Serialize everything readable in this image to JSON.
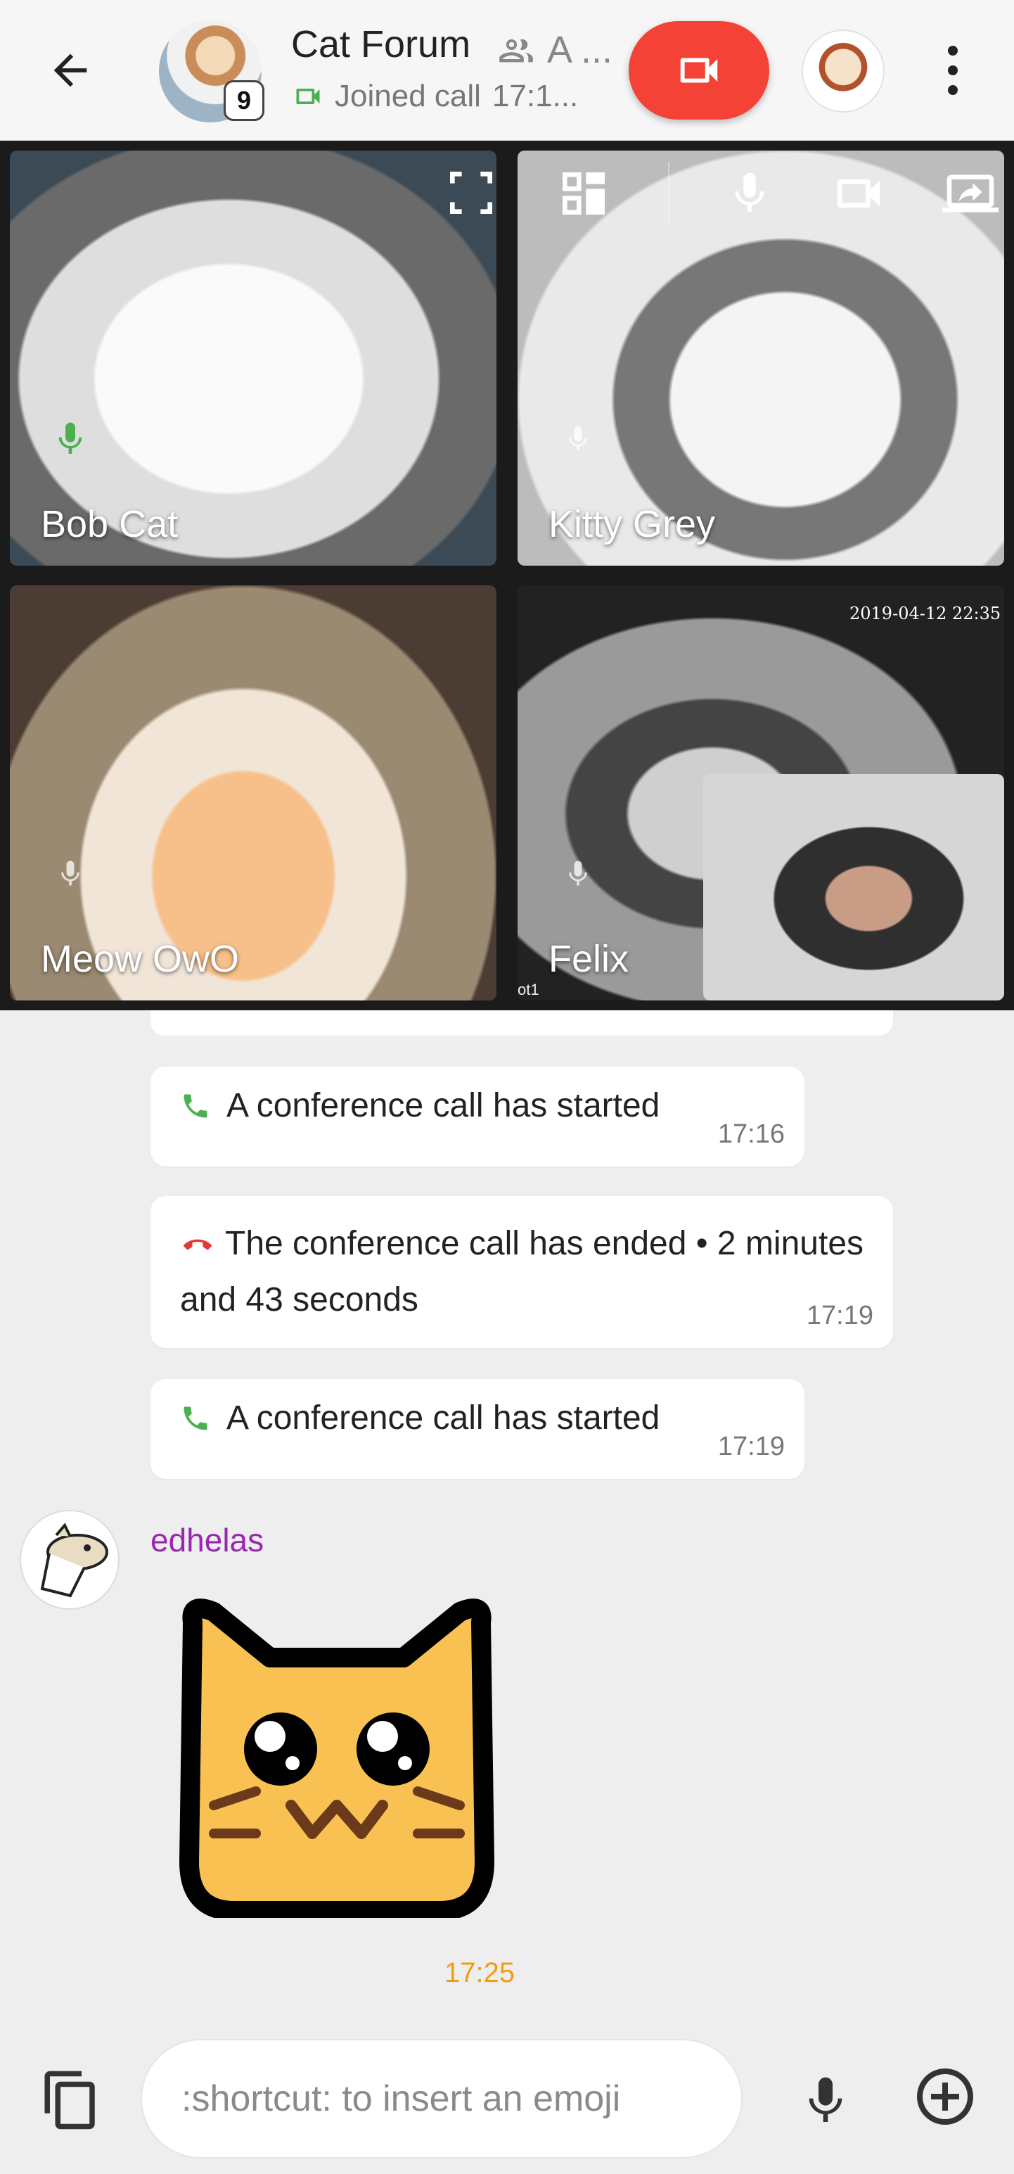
{
  "header": {
    "room_title": "Cat Forum",
    "title_extra": "A ...",
    "member_badge": "9",
    "call_status": "Joined call",
    "call_time": "17:1..."
  },
  "video": {
    "tiles": [
      {
        "name": "Bob Cat",
        "mic": "active"
      },
      {
        "name": "Kitty Grey",
        "mic": "muted"
      },
      {
        "name": "Meow OwO",
        "mic": "muted"
      },
      {
        "name": "Felix",
        "mic": "muted"
      }
    ],
    "camera_timestamp": "2019-04-12 22:35",
    "corner_label": "ot1"
  },
  "timeline": {
    "messages": [
      {
        "icon": "phone-icon",
        "text": "A conference call has started",
        "time": "17:16"
      },
      {
        "icon": "phone-hangup-icon",
        "text": "The conference call has ended • 2 minutes and 43 seconds",
        "time": "17:19"
      },
      {
        "icon": "phone-icon",
        "text": "A conference call has started",
        "time": "17:19"
      }
    ],
    "sender": "edhelas",
    "sticker_time": "17:25"
  },
  "composer": {
    "placeholder": ":shortcut: to insert an emoji"
  },
  "colors": {
    "call_button": "#f44336",
    "accent_green": "#4caf50",
    "hangup_red": "#e53935",
    "sender_name": "#9b27b0",
    "sticker_time": "#f39c12"
  }
}
